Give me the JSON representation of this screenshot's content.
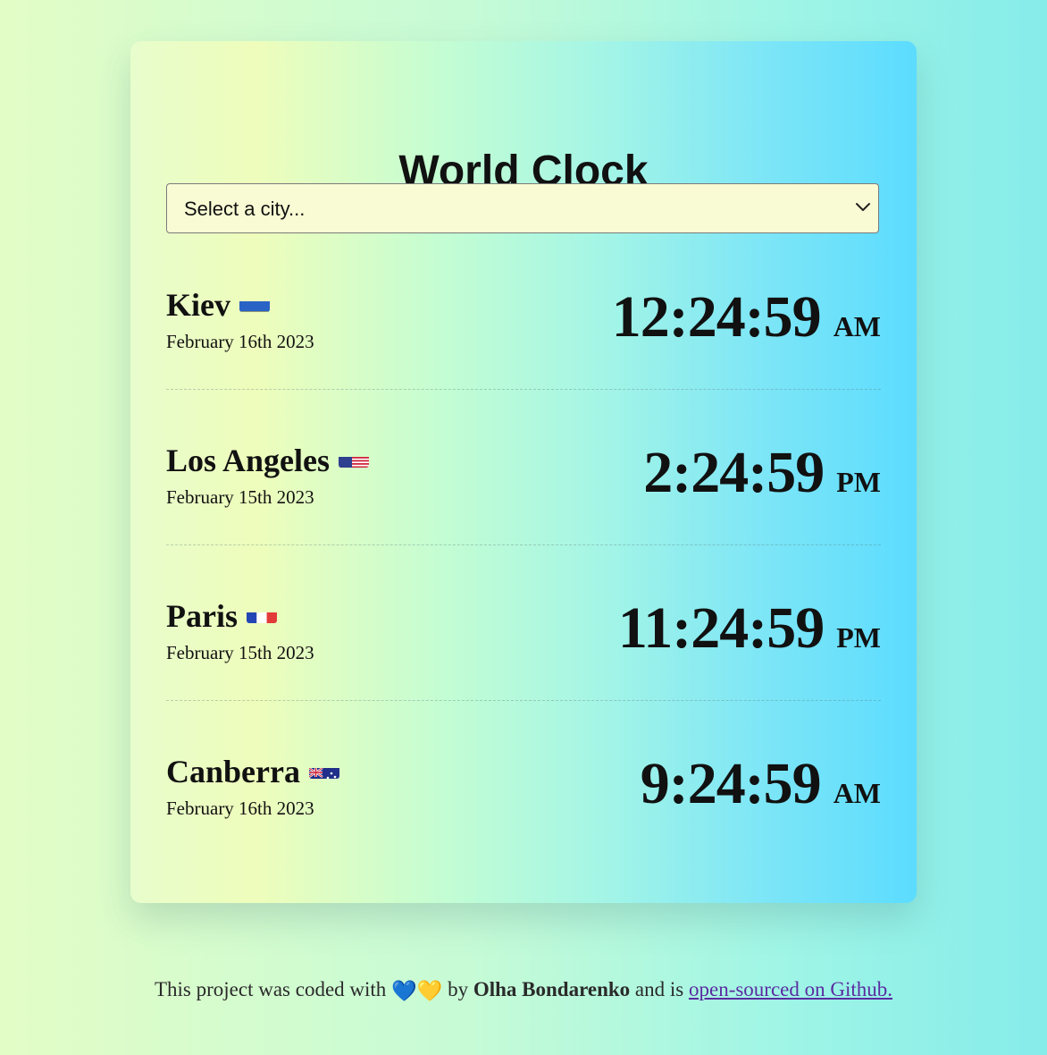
{
  "title": "World Clock",
  "select": {
    "value": "Select a city...",
    "icon": "chevron-down-icon"
  },
  "cities": [
    {
      "name": "Kiev",
      "flag": "ukraine-flag-icon",
      "date": "February 16th 2023",
      "time": "12:24:59",
      "ampm": "AM"
    },
    {
      "name": "Los Angeles",
      "flag": "usa-flag-icon",
      "date": "February 15th 2023",
      "time": "2:24:59",
      "ampm": "PM"
    },
    {
      "name": "Paris",
      "flag": "france-flag-icon",
      "date": "February 15th 2023",
      "time": "11:24:59",
      "ampm": "PM"
    },
    {
      "name": "Canberra",
      "flag": "australia-flag-icon",
      "date": "February 16th 2023",
      "time": "9:24:59",
      "ampm": "AM"
    }
  ],
  "footer": {
    "prefix": "This project was coded with",
    "hearts": "💙💛",
    "by": "by",
    "author": "Olha Bondarenko",
    "middle": "and is",
    "link_text": "open-sourced on Github."
  },
  "colors": {
    "card_gradient_start": "#eefdbb",
    "card_gradient_end": "#5cdcff",
    "select_background": "#f9fbd4",
    "link": "#5a2ca0"
  }
}
